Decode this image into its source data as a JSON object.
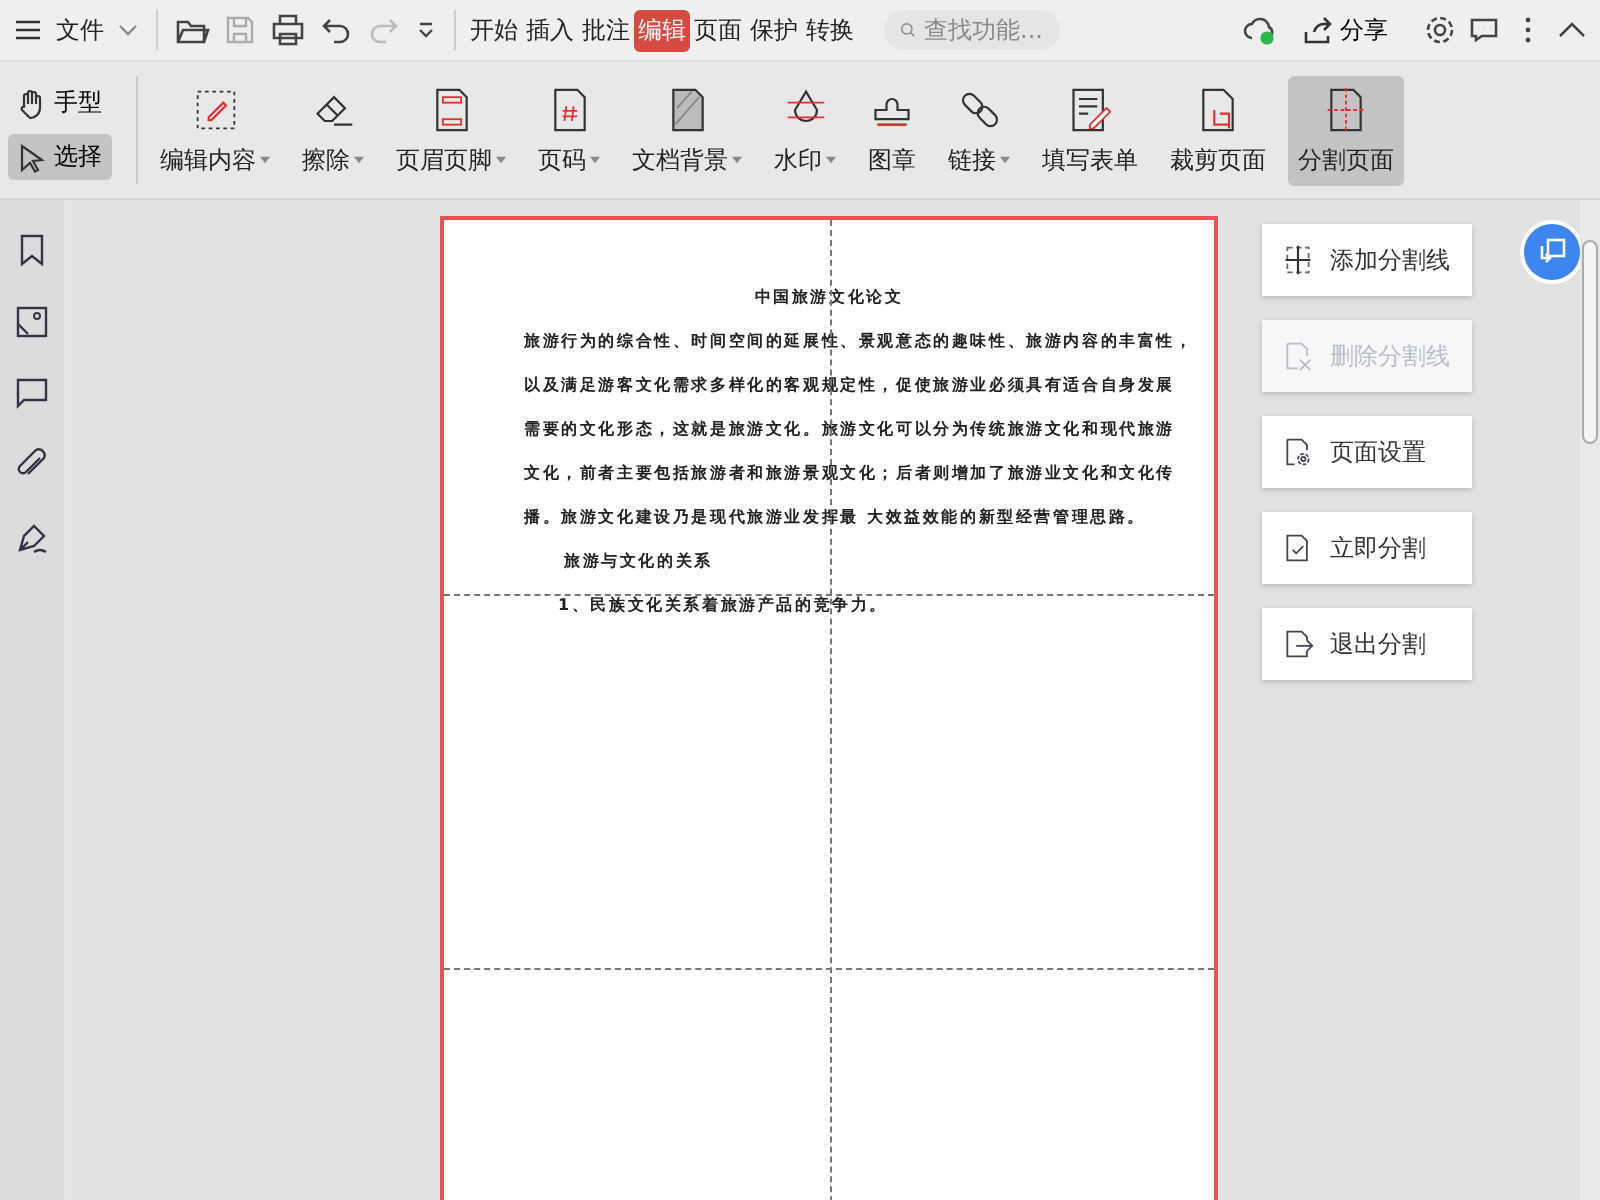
{
  "menubar": {
    "file_menu": "文件",
    "tabs": [
      {
        "label": "开始",
        "selected": false
      },
      {
        "label": "插入",
        "selected": false
      },
      {
        "label": "批注",
        "selected": false
      },
      {
        "label": "编辑",
        "selected": true
      },
      {
        "label": "页面",
        "selected": false
      },
      {
        "label": "保护",
        "selected": false
      },
      {
        "label": "转换",
        "selected": false
      }
    ],
    "search": {
      "placeholder": "查找功能..."
    },
    "share": "分享"
  },
  "toolbar": {
    "modes": [
      {
        "kind": "hand",
        "label": "手型",
        "selected": false
      },
      {
        "kind": "select",
        "label": "选择",
        "selected": true
      }
    ],
    "tools": [
      {
        "kind": "edit",
        "label": "编辑内容",
        "dropdown": true,
        "selected": false
      },
      {
        "kind": "erase",
        "label": "擦除",
        "dropdown": true,
        "selected": false
      },
      {
        "kind": "header",
        "label": "页眉页脚",
        "dropdown": true,
        "selected": false
      },
      {
        "kind": "pagenum",
        "label": "页码",
        "dropdown": true,
        "selected": false
      },
      {
        "kind": "background",
        "label": "文档背景",
        "dropdown": true,
        "selected": false
      },
      {
        "kind": "watermark",
        "label": "水印",
        "dropdown": true,
        "selected": false
      },
      {
        "kind": "stamp",
        "label": "图章",
        "dropdown": false,
        "selected": false
      },
      {
        "kind": "link",
        "label": "链接",
        "dropdown": true,
        "selected": false
      },
      {
        "kind": "form",
        "label": "填写表单",
        "dropdown": false,
        "selected": false
      },
      {
        "kind": "crop",
        "label": "裁剪页面",
        "dropdown": false,
        "selected": false
      },
      {
        "kind": "split",
        "label": "分割页面",
        "dropdown": false,
        "selected": true
      }
    ]
  },
  "document": {
    "lines": [
      {
        "kind": "title",
        "text": "中国旅游文化论文"
      },
      {
        "kind": "body",
        "text": "旅游行为的综合性、时间空间的延展性、景观意态的趣味性、旅游内容的丰富性，"
      },
      {
        "kind": "body",
        "text": "以及满足游客文化需求多样化的客观规定性，促使旅游业必须具有适合自身发展"
      },
      {
        "kind": "body",
        "text": "需要的文化形态，这就是旅游文化。旅游文化可以分为传统旅游文化和现代旅游"
      },
      {
        "kind": "body",
        "text": "文化，前者主要包括旅游者和旅游景观文化；后者则增加了旅游业文化和文化传"
      },
      {
        "kind": "body",
        "text": "播。旅游文化建设乃是现代旅游业发挥最 大效益效能的新型经营管理思路。"
      },
      {
        "kind": "heading",
        "text": "旅游与文化的关系"
      },
      {
        "kind": "list",
        "text": "1、民族文化关系着旅游产品的竞争力。"
      }
    ]
  },
  "split_panel": {
    "buttons": [
      {
        "kind": "add",
        "label": "添加分割线",
        "disabled": false
      },
      {
        "kind": "delete",
        "label": "删除分割线",
        "disabled": true
      },
      {
        "kind": "settings",
        "label": "页面设置",
        "disabled": false
      },
      {
        "kind": "apply",
        "label": "立即分割",
        "disabled": false
      },
      {
        "kind": "exit",
        "label": "退出分割",
        "disabled": false
      }
    ]
  }
}
